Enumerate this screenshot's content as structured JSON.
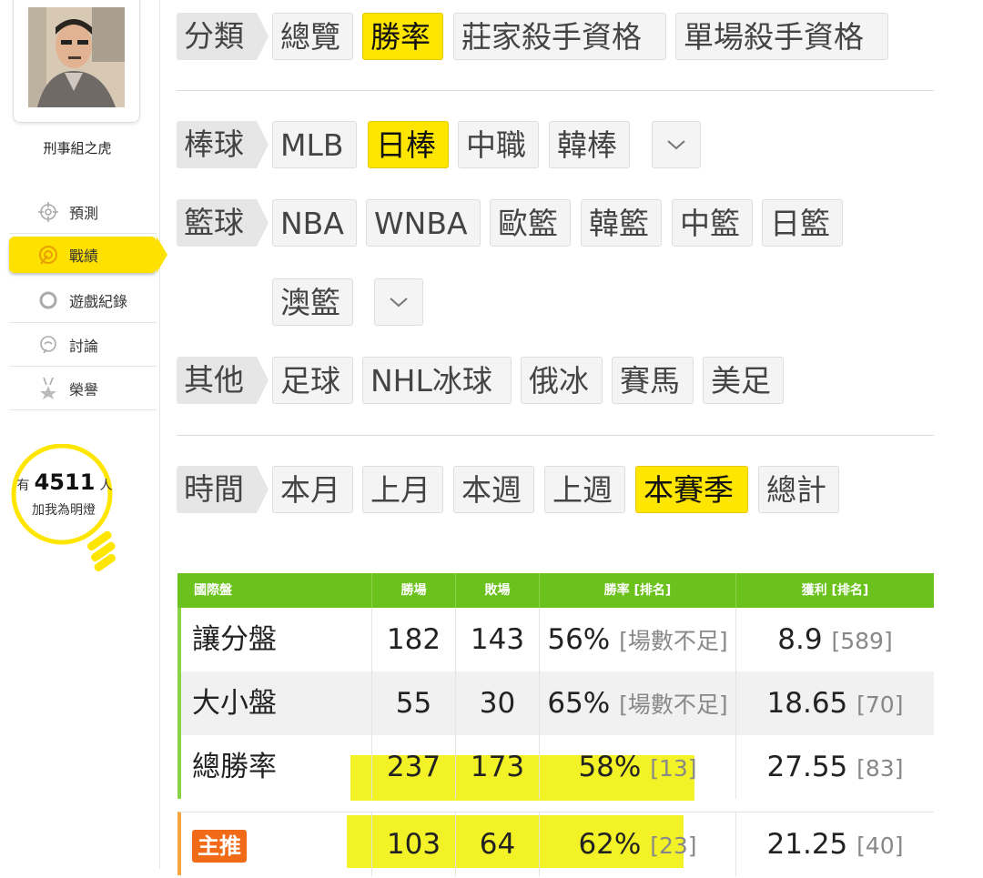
{
  "sidebar": {
    "username": "刑事組之虎",
    "items": [
      {
        "label": "預測",
        "icon": "crosshair-icon"
      },
      {
        "label": "戰績",
        "icon": "target-icon"
      },
      {
        "label": "遊戲紀錄",
        "icon": "circle-icon"
      },
      {
        "label": "討論",
        "icon": "chat-icon"
      },
      {
        "label": "榮譽",
        "icon": "medal-icon"
      }
    ],
    "fans": {
      "prefix": "有",
      "count": "4511",
      "suffix": "人",
      "caption": "加我為明燈"
    }
  },
  "filters": {
    "category": {
      "label": "分類",
      "options": [
        "總覽",
        "勝率",
        "莊家殺手資格",
        "單場殺手資格"
      ],
      "selected": "勝率"
    },
    "baseball": {
      "label": "棒球",
      "options": [
        "MLB",
        "日棒",
        "中職",
        "韓棒"
      ],
      "selected": "日棒"
    },
    "basketball": {
      "label": "籃球",
      "options": [
        "NBA",
        "WNBA",
        "歐籃",
        "韓籃",
        "中籃",
        "日籃",
        "澳籃"
      ]
    },
    "other": {
      "label": "其他",
      "options": [
        "足球",
        "NHL冰球",
        "俄冰",
        "賽馬",
        "美足"
      ]
    },
    "time": {
      "label": "時間",
      "options": [
        "本月",
        "上月",
        "本週",
        "上週",
        "本賽季",
        "總計"
      ],
      "selected": "本賽季"
    }
  },
  "table": {
    "headers": [
      "國際盤",
      "勝場",
      "敗場",
      "勝率 [排名]",
      "獲利 [排名]"
    ],
    "rows": [
      {
        "name": "讓分盤",
        "wins": "182",
        "losses": "143",
        "rate": "56%",
        "rate_rank": "[場數不足]",
        "profit": "8.9",
        "profit_rank": "[589]"
      },
      {
        "name": "大小盤",
        "wins": "55",
        "losses": "30",
        "rate": "65%",
        "rate_rank": "[場數不足]",
        "profit": "18.65",
        "profit_rank": "[70]"
      },
      {
        "name": "總勝率",
        "wins": "237",
        "losses": "173",
        "rate": "58%",
        "rate_rank": "[13]",
        "profit": "27.55",
        "profit_rank": "[83]"
      },
      {
        "name": "主推",
        "wins": "103",
        "losses": "64",
        "rate": "62%",
        "rate_rank": "[23]",
        "profit": "21.25",
        "profit_rank": "[40]"
      }
    ]
  },
  "colors": {
    "accent": "#ffe600",
    "table_header": "#6cc21c",
    "badge": "#f06a18",
    "highlight": "#f0f000"
  }
}
